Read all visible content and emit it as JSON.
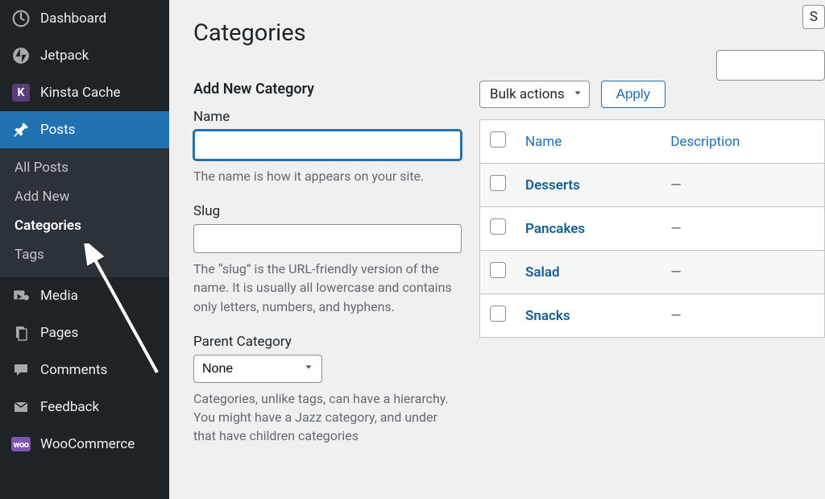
{
  "sidebar": {
    "dashboard": "Dashboard",
    "jetpack": "Jetpack",
    "kinsta": "Kinsta Cache",
    "posts": "Posts",
    "media": "Media",
    "pages": "Pages",
    "comments": "Comments",
    "feedback": "Feedback",
    "woocommerce": "WooCommerce",
    "submenu": {
      "all_posts": "All Posts",
      "add_new": "Add New",
      "categories": "Categories",
      "tags": "Tags"
    }
  },
  "page": {
    "title": "Categories"
  },
  "form": {
    "heading": "Add New Category",
    "name_label": "Name",
    "name_help": "The name is how it appears on your site.",
    "slug_label": "Slug",
    "slug_help": "The “slug” is the URL-friendly version of the name. It is usually all lowercase and contains only letters, numbers, and hyphens.",
    "parent_label": "Parent Category",
    "parent_value": "None",
    "parent_help": "Categories, unlike tags, can have a hierarchy. You might have a Jazz category, and under that have children categories"
  },
  "list": {
    "bulk_label": "Bulk actions",
    "apply_label": "Apply",
    "columns": {
      "name": "Name",
      "description": "Description"
    },
    "rows": [
      {
        "name": "Desserts",
        "description": "—"
      },
      {
        "name": "Pancakes",
        "description": "—"
      },
      {
        "name": "Salad",
        "description": "—"
      },
      {
        "name": "Snacks",
        "description": "—"
      }
    ]
  },
  "stub_button_letter": "S"
}
